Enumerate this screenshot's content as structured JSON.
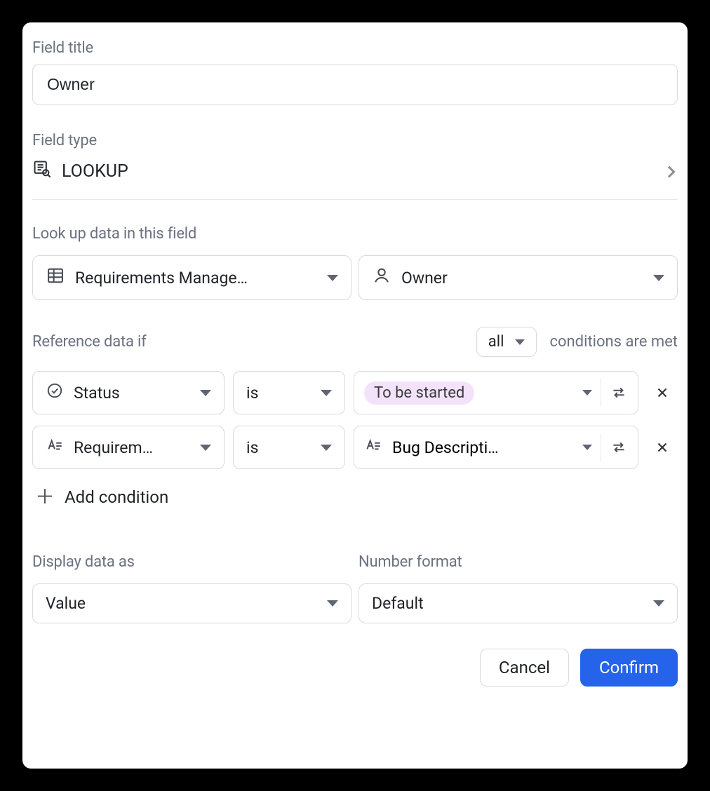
{
  "field_title": {
    "label": "Field title",
    "value": "Owner"
  },
  "field_type": {
    "label": "Field type",
    "value": "LOOKUP"
  },
  "lookup": {
    "label": "Look up data in this field",
    "table": "Requirements Manage…",
    "field": "Owner"
  },
  "reference": {
    "prefix": "Reference data if",
    "mode": "all",
    "suffix": "conditions are met",
    "conditions": [
      {
        "field": "Status",
        "op": "is",
        "value": "To be started",
        "value_type": "pill"
      },
      {
        "field": "Requirem…",
        "op": "is",
        "value": "Bug Descripti…",
        "value_type": "field"
      }
    ],
    "add_label": "Add condition"
  },
  "display": {
    "label": "Display data as",
    "value": "Value"
  },
  "number_format": {
    "label": "Number format",
    "value": "Default"
  },
  "footer": {
    "cancel": "Cancel",
    "confirm": "Confirm"
  }
}
